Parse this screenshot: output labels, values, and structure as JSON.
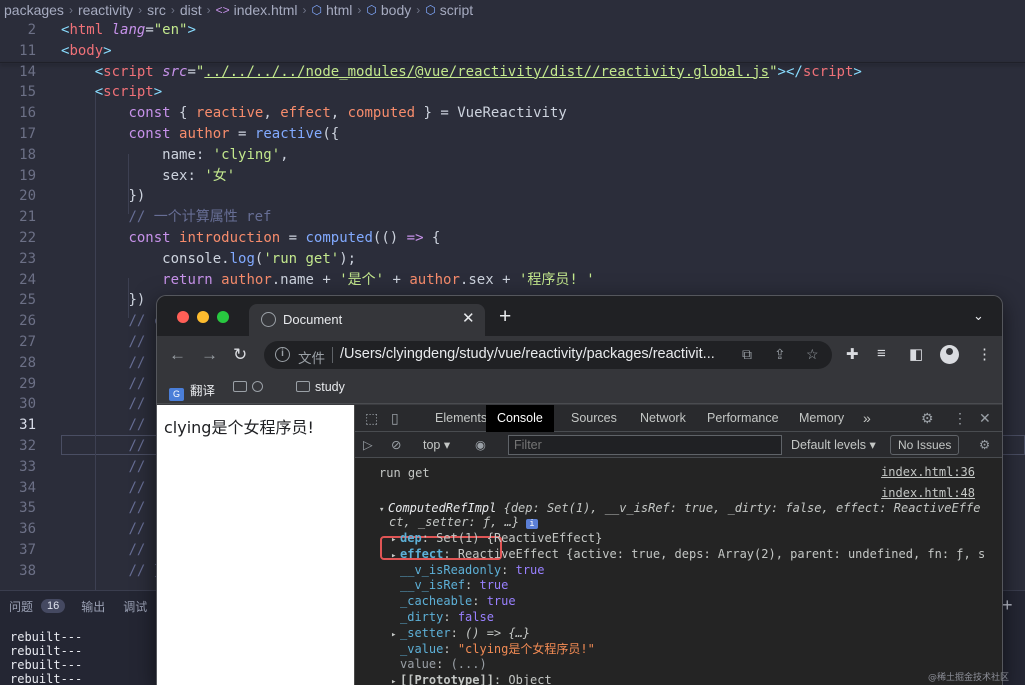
{
  "breadcrumb": [
    "packages",
    "reactivity",
    "src",
    "dist",
    "index.html",
    "html",
    "body",
    "script"
  ],
  "editor": {
    "lines": [
      {
        "n": "2",
        "t": [
          [
            "tag",
            "<"
          ],
          [
            "tn",
            "html"
          ],
          [
            "pl",
            " "
          ],
          [
            "at",
            "lang"
          ],
          [
            "pl",
            "="
          ],
          [
            "st",
            "\"en\""
          ],
          [
            "tag",
            ">"
          ]
        ]
      },
      {
        "n": "11",
        "t": [
          [
            "tag",
            "<"
          ],
          [
            "tn",
            "body"
          ],
          [
            "tag",
            ">"
          ]
        ]
      },
      {
        "n": "14",
        "t": [
          [
            "pl",
            "    "
          ],
          [
            "tag",
            "<"
          ],
          [
            "tn",
            "script"
          ],
          [
            "pl",
            " "
          ],
          [
            "at",
            "src"
          ],
          [
            "pl",
            "="
          ],
          [
            "st",
            "\""
          ],
          [
            "stu",
            "../../../../node_modules/@vue/reactivity/dist//reactivity.global.js"
          ],
          [
            "st",
            "\""
          ],
          [
            "tag",
            "></"
          ],
          [
            "tn",
            "script"
          ],
          [
            "tag",
            ">"
          ]
        ]
      },
      {
        "n": "15",
        "t": [
          [
            "pl",
            "    "
          ],
          [
            "tag",
            "<"
          ],
          [
            "tn",
            "script"
          ],
          [
            "tag",
            ">"
          ]
        ]
      },
      {
        "n": "16",
        "t": [
          [
            "pl",
            "        "
          ],
          [
            "kw",
            "const"
          ],
          [
            "pl",
            " { "
          ],
          [
            "pr",
            "reactive"
          ],
          [
            "pl",
            ", "
          ],
          [
            "pr",
            "effect"
          ],
          [
            "pl",
            ", "
          ],
          [
            "pr",
            "computed"
          ],
          [
            "pl",
            " } = "
          ],
          [
            "pl",
            "VueReactivity"
          ]
        ]
      },
      {
        "n": "17",
        "t": [
          [
            "pl",
            "        "
          ],
          [
            "kw",
            "const"
          ],
          [
            "pl",
            " "
          ],
          [
            "pr",
            "author"
          ],
          [
            "pl",
            " = "
          ],
          [
            "fn",
            "reactive"
          ],
          [
            "pl",
            "({"
          ]
        ]
      },
      {
        "n": "18",
        "t": [
          [
            "pl",
            "            "
          ],
          [
            "pl",
            "name"
          ],
          [
            "pl",
            ": "
          ],
          [
            "st",
            "'clying'"
          ],
          [
            "pl",
            ","
          ]
        ]
      },
      {
        "n": "19",
        "t": [
          [
            "pl",
            "            "
          ],
          [
            "pl",
            "sex"
          ],
          [
            "pl",
            ": "
          ],
          [
            "st",
            "'女'"
          ]
        ]
      },
      {
        "n": "20",
        "t": [
          [
            "pl",
            "        "
          ],
          [
            "pl",
            "})"
          ]
        ]
      },
      {
        "n": "21",
        "t": [
          [
            "pl",
            "        "
          ],
          [
            "cm",
            "// 一个计算属性 ref"
          ]
        ]
      },
      {
        "n": "22",
        "t": [
          [
            "pl",
            "        "
          ],
          [
            "kw",
            "const"
          ],
          [
            "pl",
            " "
          ],
          [
            "pr",
            "introduction"
          ],
          [
            "pl",
            " = "
          ],
          [
            "fn",
            "computed"
          ],
          [
            "pl",
            "(() "
          ],
          [
            "kw",
            "=>"
          ],
          [
            "pl",
            " {"
          ]
        ]
      },
      {
        "n": "23",
        "t": [
          [
            "pl",
            "            "
          ],
          [
            "pl",
            "console"
          ],
          [
            "pl",
            "."
          ],
          [
            "fn",
            "log"
          ],
          [
            "pl",
            "("
          ],
          [
            "st",
            "'run get'"
          ],
          [
            "pl",
            ");"
          ]
        ]
      },
      {
        "n": "24",
        "t": [
          [
            "pl",
            "            "
          ],
          [
            "kw",
            "return"
          ],
          [
            "pl",
            " "
          ],
          [
            "pr",
            "author"
          ],
          [
            "pl",
            ".name + "
          ],
          [
            "st",
            "'是个'"
          ],
          [
            "pl",
            " + "
          ],
          [
            "pr",
            "author"
          ],
          [
            "pl",
            ".sex + "
          ],
          [
            "st",
            "'程序员! '"
          ]
        ]
      },
      {
        "n": "25",
        "t": [
          [
            "pl",
            "        "
          ],
          [
            "pl",
            "})"
          ]
        ]
      },
      {
        "n": "26",
        "t": [
          [
            "pl",
            "        "
          ],
          [
            "cm",
            "// c"
          ]
        ]
      },
      {
        "n": "27",
        "t": [
          [
            "pl",
            "        "
          ],
          [
            "cm",
            "//"
          ]
        ]
      },
      {
        "n": "28",
        "t": [
          [
            "pl",
            "        "
          ],
          [
            "cm",
            "//"
          ]
        ]
      },
      {
        "n": "29",
        "t": [
          [
            "pl",
            "        "
          ],
          [
            "cm",
            "//"
          ]
        ]
      },
      {
        "n": "30",
        "t": [
          [
            "pl",
            "        "
          ],
          [
            "cm",
            "//"
          ]
        ]
      },
      {
        "n": "31",
        "t": [
          [
            "pl",
            "        "
          ],
          [
            "cm",
            "//"
          ]
        ]
      },
      {
        "n": "32",
        "t": [
          [
            "pl",
            "        "
          ],
          [
            "cm",
            "//"
          ]
        ]
      },
      {
        "n": "33",
        "t": [
          [
            "pl",
            "        "
          ],
          [
            "cm",
            "//"
          ]
        ]
      },
      {
        "n": "34",
        "t": [
          [
            "pl",
            "        "
          ],
          [
            "cm",
            "//"
          ]
        ]
      },
      {
        "n": "35",
        "t": [
          [
            "pl",
            "        "
          ],
          [
            "cm",
            "//"
          ]
        ]
      },
      {
        "n": "36",
        "t": [
          [
            "pl",
            "        "
          ],
          [
            "cm",
            "//"
          ]
        ]
      },
      {
        "n": "37",
        "t": [
          [
            "pl",
            "        "
          ],
          [
            "cm",
            "//"
          ]
        ]
      },
      {
        "n": "38",
        "t": [
          [
            "pl",
            "        "
          ],
          [
            "cm",
            "// }"
          ]
        ]
      }
    ]
  },
  "panel": {
    "problems_label": "问题",
    "problems_count": "16",
    "output_label": "输出",
    "debug_label": "调试",
    "terminal_lines": [
      "rebuilt---",
      "rebuilt---",
      "rebuilt---",
      "rebuilt---"
    ]
  },
  "browser": {
    "tab_title": "Document",
    "url_label": "文件",
    "url": "/Users/clyingdeng/study/vue/reactivity/packages/reactivit...",
    "bookmarks": {
      "translate": "翻译",
      "study": "study"
    },
    "page_text": "clying是个女程序员!",
    "colors": {
      "red": "#ff5f57",
      "yellow": "#febc2e",
      "green": "#28c840"
    }
  },
  "devtools": {
    "tabs": [
      "Elements",
      "Console",
      "Sources",
      "Network",
      "Performance",
      "Memory"
    ],
    "active_tab": "Console",
    "context": "top",
    "filter_placeholder": "Filter",
    "levels": "Default levels",
    "issues": "No Issues",
    "log1": {
      "text": "run get",
      "src": "index.html:36"
    },
    "log2_src": "index.html:48",
    "obj_name": "ComputedRefImpl",
    "obj_summary": "{dep: Set(1), __v_isRef: true, _dirty: false, effect: ReactiveEffe",
    "obj_summary2": "ct, _setter: ƒ, …}",
    "props": [
      {
        "k": "dep",
        "v": "Set(1) {ReactiveEffect}",
        "expand": true,
        "type": "plain"
      },
      {
        "k": "effect",
        "v": "ReactiveEffect {active: true, deps: Array(2), parent: undefined, fn: ƒ, s",
        "expand": true,
        "type": "plain"
      },
      {
        "k": "__v_isReadonly",
        "v": "true",
        "expand": false,
        "type": "bool"
      },
      {
        "k": "__v_isRef",
        "v": "true",
        "expand": false,
        "type": "bool"
      },
      {
        "k": "_cacheable",
        "v": "true",
        "expand": false,
        "type": "bool"
      },
      {
        "k": "_dirty",
        "v": "false",
        "expand": false,
        "type": "bool"
      },
      {
        "k": "_setter",
        "v": "() => {…}",
        "expand": true,
        "type": "fn"
      },
      {
        "k": "_value",
        "v": "\"clying是个女程序员!\"",
        "expand": false,
        "type": "str"
      },
      {
        "k": "value",
        "v": "(...)",
        "expand": false,
        "type": "getter"
      },
      {
        "k": "[[Prototype]]",
        "v": "Object",
        "expand": true,
        "type": "plain"
      }
    ]
  },
  "watermark": "@稀土掘金技术社区"
}
